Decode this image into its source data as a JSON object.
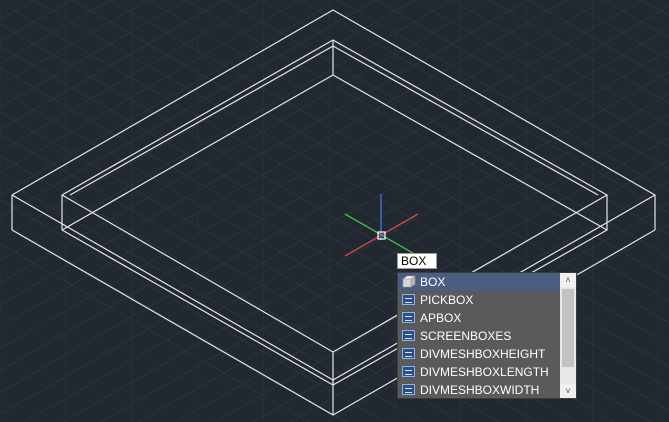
{
  "viewport": {
    "background_color": "#212830",
    "grid_color": "#2b333d",
    "wireframe_color": "#e6e6e6",
    "ucs_x_color": "#d64b4b",
    "ucs_y_color": "#3fc24a",
    "ucs_z_color": "#4a6fe0"
  },
  "command_input": {
    "value": "BOX"
  },
  "autocomplete": {
    "selected_index": 0,
    "items": [
      {
        "label": "BOX",
        "icon": "box-3d-icon",
        "type": "command"
      },
      {
        "label": "PICKBOX",
        "icon": "system-variable-icon",
        "type": "sysvar"
      },
      {
        "label": "APBOX",
        "icon": "system-variable-icon",
        "type": "sysvar"
      },
      {
        "label": "SCREENBOXES",
        "icon": "system-variable-icon",
        "type": "sysvar"
      },
      {
        "label": "DIVMESHBOXHEIGHT",
        "icon": "system-variable-icon",
        "type": "sysvar"
      },
      {
        "label": "DIVMESHBOXLENGTH",
        "icon": "system-variable-icon",
        "type": "sysvar"
      },
      {
        "label": "DIVMESHBOXWIDTH",
        "icon": "system-variable-icon",
        "type": "sysvar"
      }
    ],
    "selection_color": "#4b5e82",
    "scrollbar": {
      "up_glyph": "˄",
      "down_glyph": "˅"
    }
  }
}
